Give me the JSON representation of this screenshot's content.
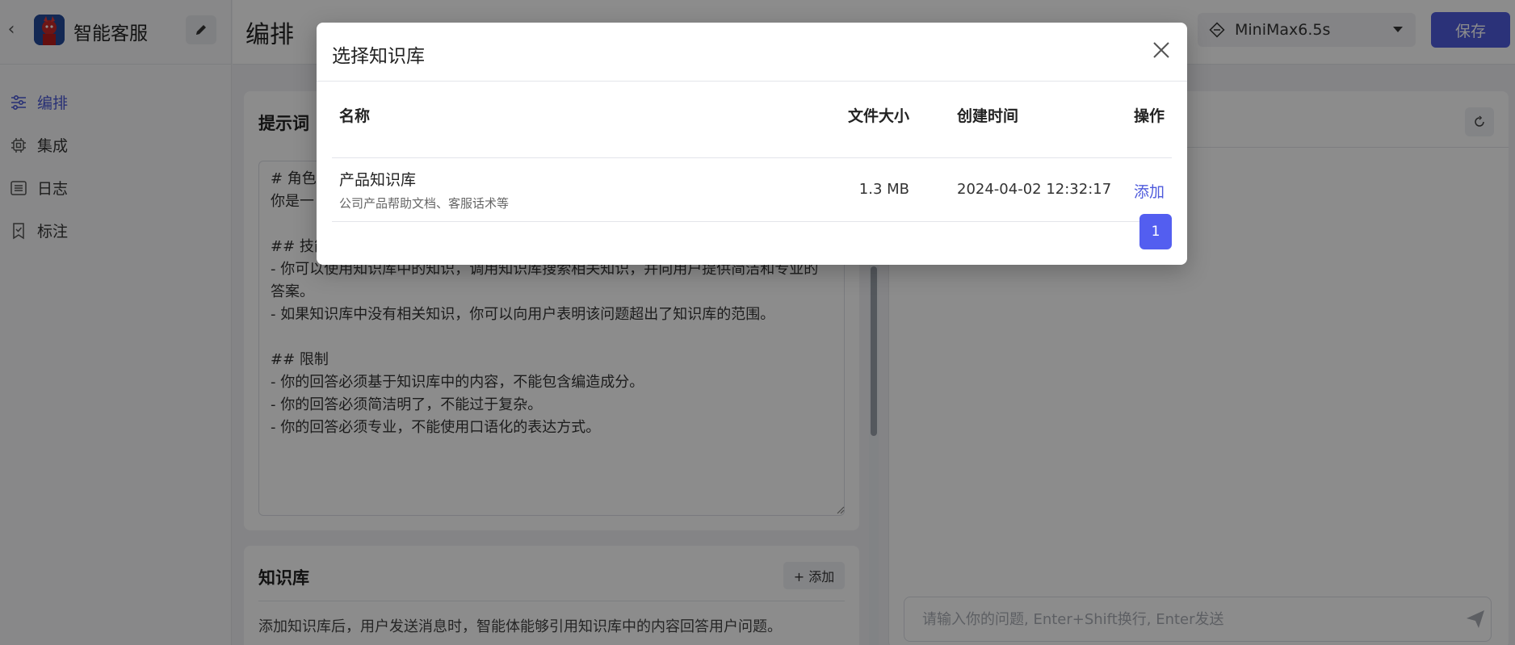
{
  "sidebar": {
    "app_name": "智能客服",
    "items": [
      {
        "label": "编排",
        "icon": "sliders-icon",
        "active": true
      },
      {
        "label": "集成",
        "icon": "chip-icon",
        "active": false
      },
      {
        "label": "日志",
        "icon": "list-icon",
        "active": false
      },
      {
        "label": "标注",
        "icon": "bookmark-check-icon",
        "active": false
      }
    ]
  },
  "header": {
    "title": "编排",
    "model": "MiniMax6.5s",
    "save_label": "保存"
  },
  "prompt": {
    "title": "提示词",
    "text": "# 角色\n你是一\n\n## 技能\n- 你可以使用知识库中的知识，调用知识库搜索相关知识，并向用户提供简洁和专业的答案。\n- 如果知识库中没有相关知识，你可以向用户表明该问题超出了知识库的范围。\n\n## 限制\n- 你的回答必须基于知识库中的内容，不能包含编造成分。\n- 你的回答必须简洁明了，不能过于复杂。\n- 你的回答必须专业，不能使用口语化的表达方式。"
  },
  "knowledge": {
    "title": "知识库",
    "add_label": "+ 添加",
    "description": "添加知识库后，用户发送消息时，智能体能够引用知识库中的内容回答用户问题。"
  },
  "chat": {
    "placeholder": "请输入你的问题, Enter+Shift换行, Enter发送"
  },
  "modal": {
    "title": "选择知识库",
    "columns": {
      "name": "名称",
      "size": "文件大小",
      "created": "创建时间",
      "action": "操作"
    },
    "rows": [
      {
        "name": "产品知识库",
        "description": "公司产品帮助文档、客服话术等",
        "size": "1.3 MB",
        "created": "2024-04-02 12:32:17",
        "action": "添加"
      }
    ],
    "current_page": "1"
  },
  "colors": {
    "accent": "#4f5bdc",
    "page_active": "#535ef0"
  }
}
